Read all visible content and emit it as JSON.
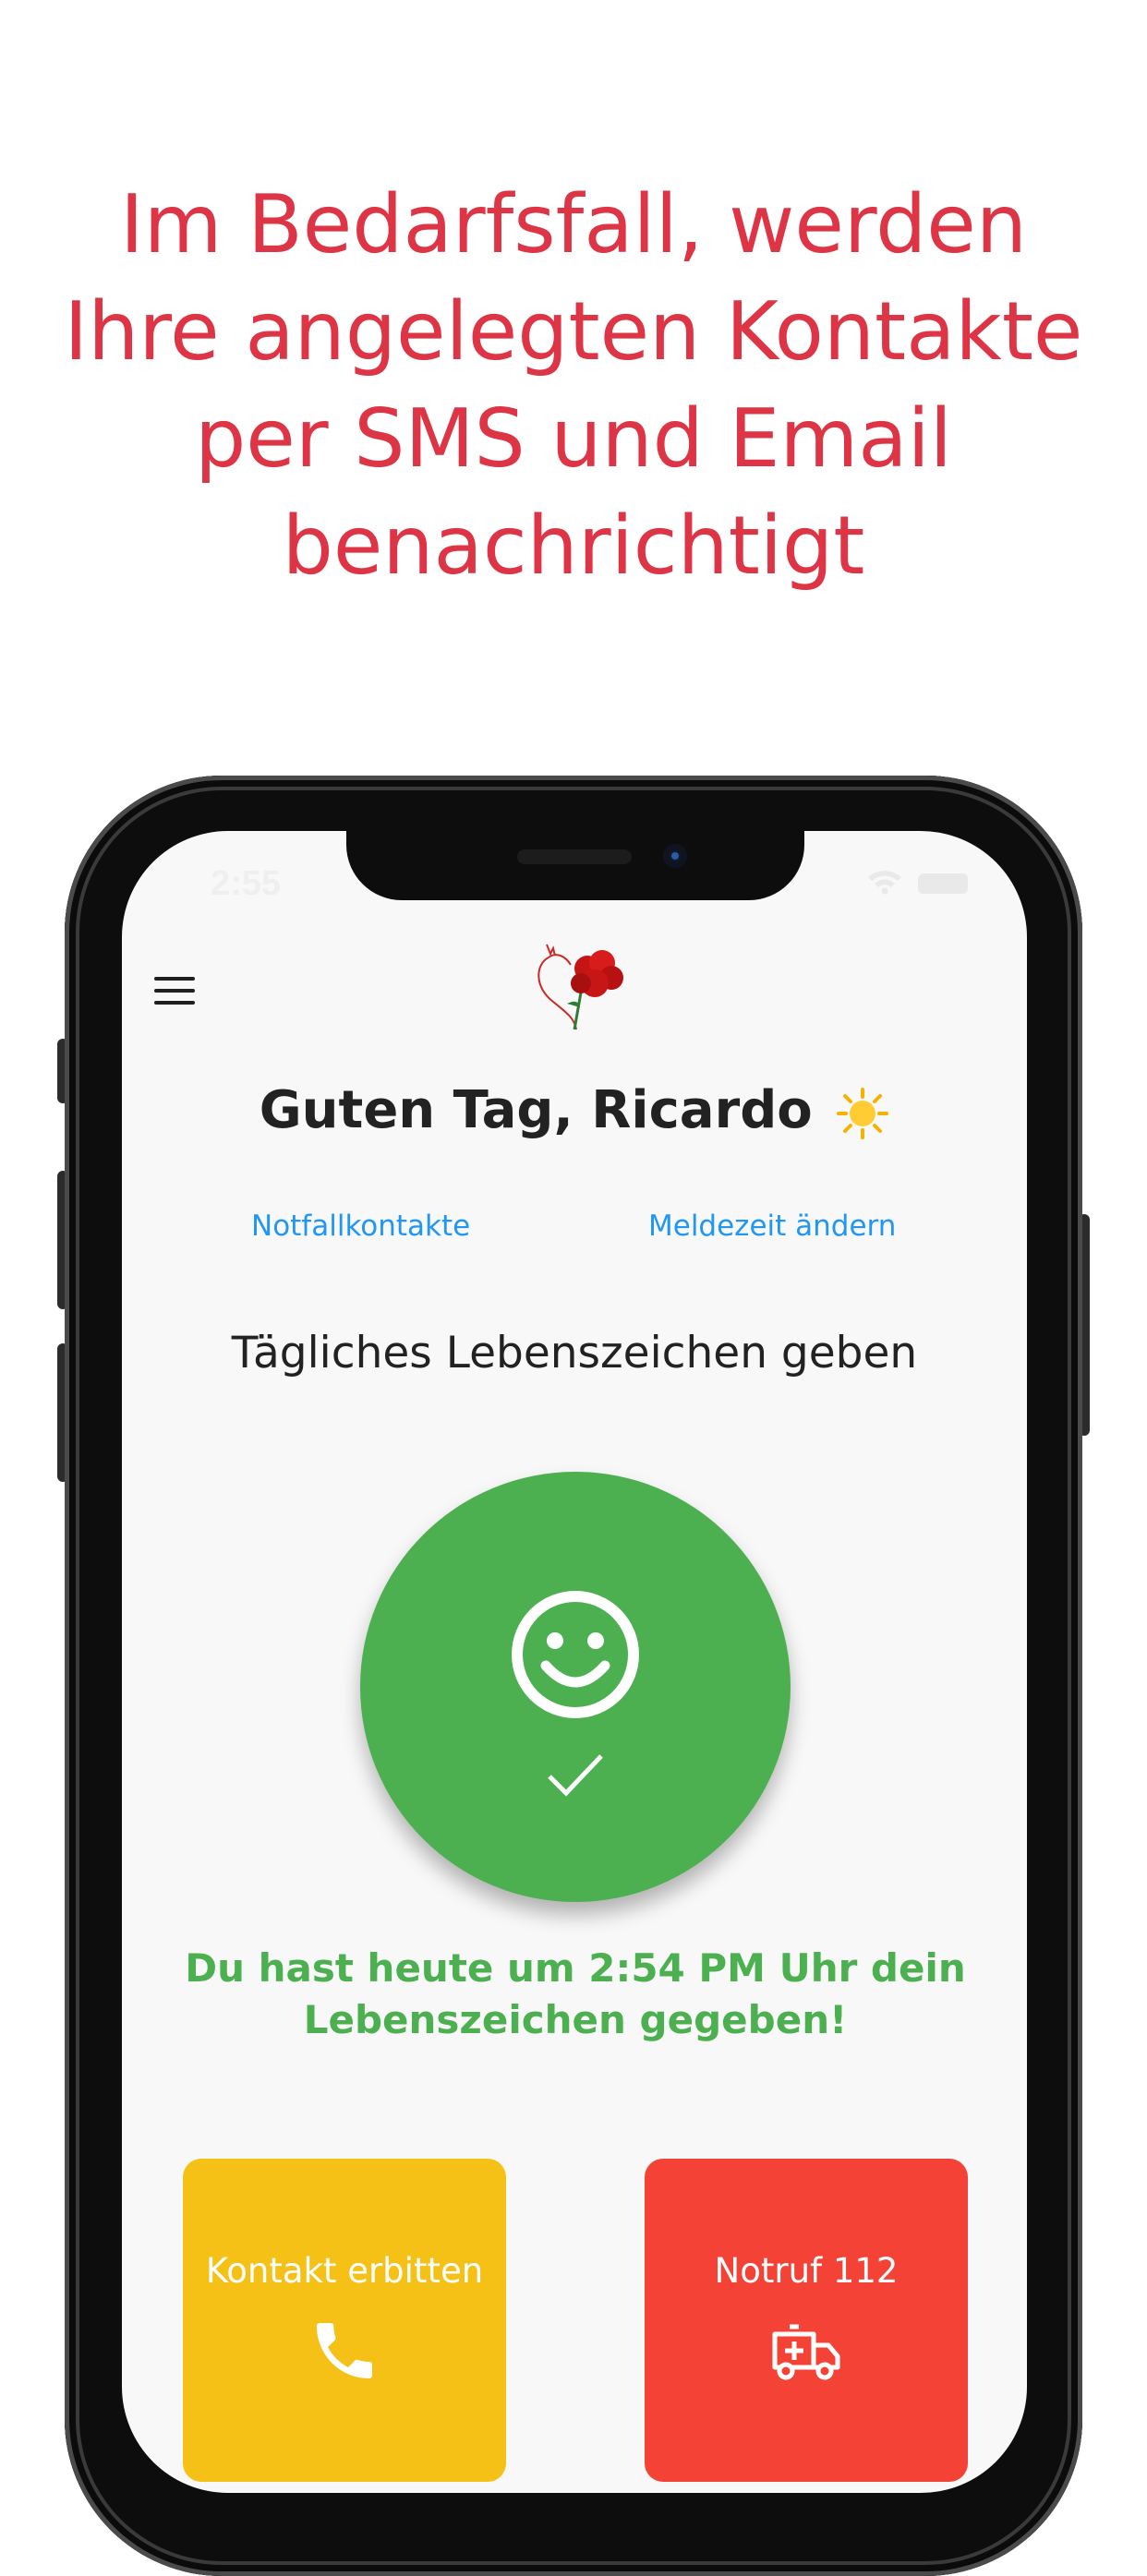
{
  "headline": "Im Bedarfsfall, werden Ihre angelegten Kontakte per SMS und Email benachrichtigt",
  "status_bar": {
    "time": "2:55"
  },
  "app": {
    "greeting": "Guten Tag, Ricardo",
    "links": {
      "contacts": "Notfallkontakte",
      "change_time": "Meldezeit ändern"
    },
    "subtitle": "Tägliches Lebenszeichen geben",
    "confirmation": "Du hast heute um 2:54 PM Uhr dein Lebenszeichen gegeben!",
    "tiles": {
      "contact": "Kontakt erbitten",
      "emergency": "Notruf 112"
    }
  },
  "icons": [
    "menu-icon",
    "logo-heart-carnation",
    "sun-icon",
    "smiley-icon",
    "checkmark-icon",
    "phone-icon",
    "ambulance-icon",
    "wifi-icon",
    "battery-icon"
  ],
  "colors": {
    "headline": "#dd3545",
    "link": "#2196f3",
    "green": "#4caf50",
    "yellow": "#f5c117",
    "red": "#f44336"
  }
}
